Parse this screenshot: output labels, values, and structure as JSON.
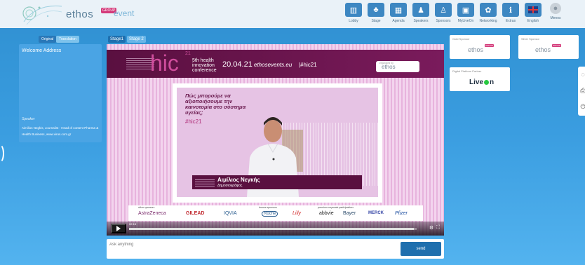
{
  "header": {
    "logo": {
      "word": "ethos",
      "group_badge": "GROUP",
      "event": "event"
    },
    "nav": [
      {
        "label": "Lobby",
        "icon": "lobby-icon"
      },
      {
        "label": "Stage",
        "icon": "stage-icon"
      },
      {
        "label": "Agenda",
        "icon": "agenda-icon"
      },
      {
        "label": "Speakers",
        "icon": "speakers-icon"
      },
      {
        "label": "Sponsors",
        "icon": "sponsors-icon"
      },
      {
        "label": "MyLiveOn",
        "icon": "myliveon-icon"
      },
      {
        "label": "Networking",
        "icon": "networking-icon"
      },
      {
        "label": "Extras",
        "icon": "extras-icon"
      },
      {
        "label": "English",
        "icon": "uk-flag-icon"
      },
      {
        "label": "Menos",
        "icon": "user-avatar-icon"
      }
    ]
  },
  "left_panel": {
    "tabs": {
      "original": "Original",
      "translation": "Translation"
    },
    "title": "Welcome Address",
    "role": "Speaker",
    "description": "Aimilios Negkis, Journalist - Head of content Pharma & Health Business, www.virus.com.gr"
  },
  "stage_tabs": {
    "stage1": "Stage1",
    "stage2": "Stage 2"
  },
  "video": {
    "banner": {
      "hic": "hic",
      "sup": "21",
      "conference": "5th health innovation conference",
      "date": "20.04.21",
      "site": "ethosevents.eu",
      "hashtag": "|#hic21",
      "organizer_label": "Organized by",
      "organizer": "ethos"
    },
    "slide_text": "Πώς μπορούμε να αξιοποιήσουμε την καινοτομία στο σύστημα υγείας;",
    "slide_tag": "#hic21",
    "speaker_name": "Αιμίλιος Νεγκής",
    "speaker_role": "Δημοσιογράφος",
    "sponsor_labels": {
      "silver": "silver sponsors",
      "bronze": "bronze sponsors",
      "premium": "premium corporate participations"
    },
    "sponsors": [
      "AstraZeneca",
      "GILEAD",
      "IQVIA",
      "Roche",
      "Lilly",
      "abbvie",
      "Bayer",
      "MERCK",
      "Pfizer"
    ],
    "time": "02:18",
    "progress": 0.99
  },
  "ask": {
    "placeholder": "Ask anything",
    "send": "send"
  },
  "right_cards": {
    "gold": {
      "title": "Gold Sponsor",
      "logo": "ethos"
    },
    "silver": {
      "title": "Silver Sponsor",
      "logo": "ethos"
    },
    "digital": {
      "title": "Digital Platform Partner",
      "logo": "Live On"
    }
  }
}
